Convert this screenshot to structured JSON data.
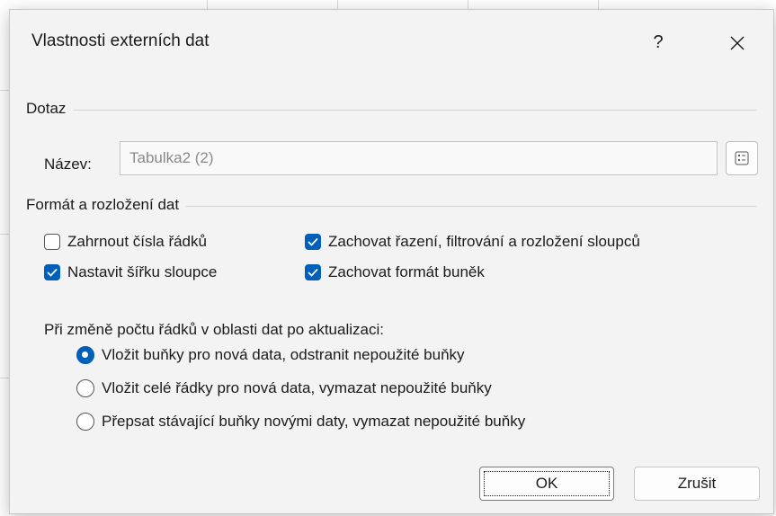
{
  "dialog": {
    "title": "Vlastnosti externích dat",
    "help_label": "?",
    "close_label": "✕"
  },
  "query_group": {
    "label": "Dotaz",
    "name_label": "Název:",
    "name_value": "Tabulka2 (2)"
  },
  "format_group": {
    "label": "Formát a rozložení dat",
    "checkboxes": [
      {
        "text": "Zahrnout čísla řádků",
        "checked": false
      },
      {
        "text": "Zachovat řazení, filtrování a rozložení sloupců",
        "checked": true
      },
      {
        "text": "Nastavit šířku sloupce",
        "checked": true
      },
      {
        "text": "Zachovat formát buněk",
        "checked": true
      }
    ],
    "question": "Při změně počtu řádků v oblasti dat po aktualizaci:",
    "radios": [
      {
        "text": "Vložit buňky pro nová data, odstranit nepoužité buňky",
        "selected": true
      },
      {
        "text": "Vložit celé řádky pro nová data, vymazat nepoužité buňky",
        "selected": false
      },
      {
        "text": "Přepsat stávající buňky novými daty, vymazat nepoužité buňky",
        "selected": false
      }
    ]
  },
  "buttons": {
    "ok": "OK",
    "cancel": "Zrušit"
  },
  "colors": {
    "accent": "#005fb8",
    "dialog_bg": "#f3f3f3"
  }
}
